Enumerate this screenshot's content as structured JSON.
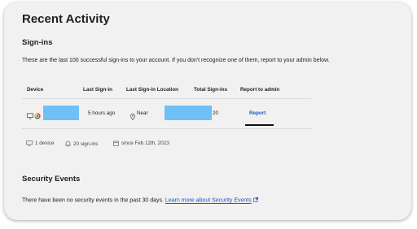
{
  "page": {
    "title": "Recent Activity"
  },
  "signins": {
    "heading": "Sign-ins",
    "description": "These are the last 100 successful sign-ins to your account. If you don't recognize one of them, report to your admin below.",
    "columns": [
      "Device",
      "Last Sign-in",
      "Last Sign-in Location",
      "Total Sign-ins",
      "Report to admin"
    ],
    "rows": [
      {
        "device_icon": "monitor-icon",
        "browser_icon": "chrome-icon",
        "last_signin": "5 hours ago",
        "location_prefix": "Near",
        "total": "20",
        "report_label": "Report"
      }
    ],
    "stats": {
      "devices": "1 device",
      "signins": "20 sign-ins",
      "since": "since Feb 12th, 2023"
    }
  },
  "security": {
    "heading": "Security Events",
    "description": "There have been no security events in the past 30 days.",
    "link": "Learn more about Security Events"
  },
  "colors": {
    "card_bg": "#f1f1f1",
    "redaction": "#6ec0f7",
    "link": "#1a56c4"
  }
}
